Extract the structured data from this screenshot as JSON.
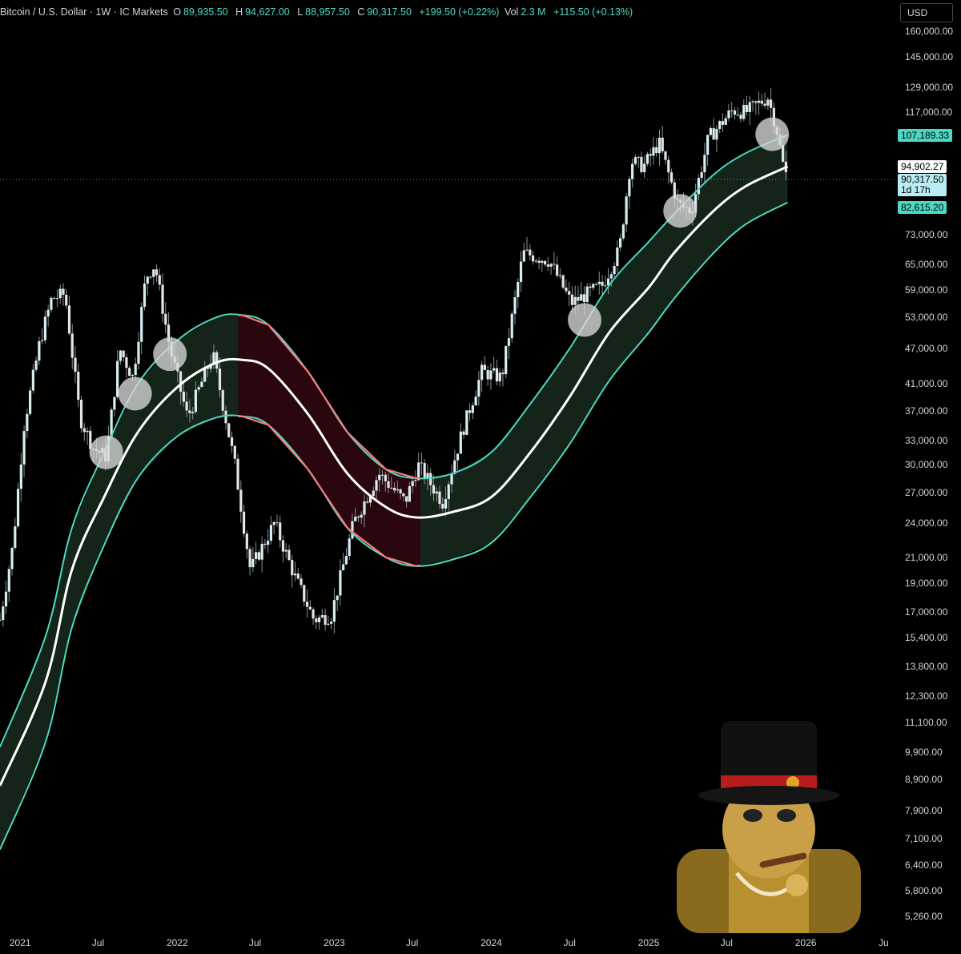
{
  "header": {
    "symbol": "Bitcoin / U.S. Dollar · 1W · IC Markets",
    "open_key": "O",
    "open": "89,935.50",
    "high_key": "H",
    "high": "94,627.00",
    "low_key": "L",
    "low": "88,957.50",
    "close_key": "C",
    "close": "90,317.50",
    "change": "+199.50 (+0.22%)",
    "vol_key": "Vol",
    "vol": "2.3 M",
    "vol_change": "+115.50 (+0.13%)"
  },
  "currency": "USD",
  "colors": {
    "accent": "#4dd8c4",
    "band_up_fill": "#142418",
    "band_down_fill": "#2a060e",
    "band_down_edge": "#f77c80",
    "midline": "#ffffff",
    "candle_up": "#d6eef2",
    "candle_down": "#e5e5e5",
    "wick": "#8a8f95",
    "touch_marker": "#d9d9d9",
    "mascot": "gold top-hat cigar bitcoin character"
  },
  "tags": {
    "upper_band": "107,189.33",
    "mid_line": "94,902.27",
    "close_price": "90,317.50",
    "countdown": "1d 17h",
    "lower_band": "82,615.20"
  },
  "chart_data": {
    "type": "line",
    "scale": "log",
    "ylim": [
      5000,
      175000
    ],
    "xlim": [
      "2020-11-15",
      "2026-08-01"
    ],
    "x_tick_labels": [
      {
        "date": "2021-01-01",
        "label": "2021"
      },
      {
        "date": "2021-07-01",
        "label": "Jul"
      },
      {
        "date": "2022-01-01",
        "label": "2022"
      },
      {
        "date": "2022-07-01",
        "label": "Jul"
      },
      {
        "date": "2023-01-01",
        "label": "2023"
      },
      {
        "date": "2023-07-01",
        "label": "Jul"
      },
      {
        "date": "2024-01-01",
        "label": "2024"
      },
      {
        "date": "2024-07-01",
        "label": "Jul"
      },
      {
        "date": "2025-01-01",
        "label": "2025"
      },
      {
        "date": "2025-07-01",
        "label": "Jul"
      },
      {
        "date": "2026-01-01",
        "label": "2026"
      },
      {
        "date": "2026-07-01",
        "label": "Ju"
      }
    ],
    "y_tick_labels": [
      {
        "value": 160000,
        "label": "160,000.00"
      },
      {
        "value": 145000,
        "label": "145,000.00"
      },
      {
        "value": 129000,
        "label": "129,000.00"
      },
      {
        "value": 117000,
        "label": "117,000.00"
      },
      {
        "value": 73000,
        "label": "73,000.00"
      },
      {
        "value": 65000,
        "label": "65,000.00"
      },
      {
        "value": 59000,
        "label": "59,000.00"
      },
      {
        "value": 53000,
        "label": "53,000.00"
      },
      {
        "value": 47000,
        "label": "47,000.00"
      },
      {
        "value": 41000,
        "label": "41,000.00"
      },
      {
        "value": 37000,
        "label": "37,000.00"
      },
      {
        "value": 33000,
        "label": "33,000.00"
      },
      {
        "value": 30000,
        "label": "30,000.00"
      },
      {
        "value": 27000,
        "label": "27,000.00"
      },
      {
        "value": 24000,
        "label": "24,000.00"
      },
      {
        "value": 21000,
        "label": "21,000.00"
      },
      {
        "value": 19000,
        "label": "19,000.00"
      },
      {
        "value": 17000,
        "label": "17,000.00"
      },
      {
        "value": 15400,
        "label": "15,400.00"
      },
      {
        "value": 13800,
        "label": "13,800.00"
      },
      {
        "value": 12300,
        "label": "12,300.00"
      },
      {
        "value": 11100,
        "label": "11,100.00"
      },
      {
        "value": 9900,
        "label": "9,900.00"
      },
      {
        "value": 8900,
        "label": "8,900.00"
      },
      {
        "value": 7900,
        "label": "7,900.00"
      },
      {
        "value": 7100,
        "label": "7,100.00"
      },
      {
        "value": 6400,
        "label": "6,400.00"
      },
      {
        "value": 5800,
        "label": "5,800.00"
      },
      {
        "value": 5260,
        "label": "5,260.00"
      }
    ],
    "series": [
      {
        "role": "upper-band",
        "points": [
          [
            "2020-11-15",
            10100
          ],
          [
            "2021-03-01",
            15500
          ],
          [
            "2021-05-01",
            23500
          ],
          [
            "2021-07-15",
            31500
          ],
          [
            "2021-10-01",
            41000
          ],
          [
            "2022-01-01",
            48500
          ],
          [
            "2022-04-01",
            53000
          ],
          [
            "2022-06-01",
            53500
          ],
          [
            "2022-08-01",
            51500
          ],
          [
            "2022-11-01",
            43000
          ],
          [
            "2023-02-01",
            34000
          ],
          [
            "2023-05-01",
            29500
          ],
          [
            "2023-07-10",
            28500
          ],
          [
            "2023-10-01",
            29000
          ],
          [
            "2024-01-01",
            31500
          ],
          [
            "2024-04-01",
            38000
          ],
          [
            "2024-07-01",
            47000
          ],
          [
            "2024-10-01",
            60000
          ],
          [
            "2025-01-01",
            71000
          ],
          [
            "2025-03-01",
            79000
          ],
          [
            "2025-06-01",
            92000
          ],
          [
            "2025-08-15",
            100000
          ],
          [
            "2025-11-20",
            107189.33
          ]
        ]
      },
      {
        "role": "mid-line",
        "points": [
          [
            "2020-11-15",
            8700
          ],
          [
            "2021-03-01",
            13000
          ],
          [
            "2021-05-01",
            20000
          ],
          [
            "2021-07-15",
            26500
          ],
          [
            "2021-10-01",
            34000
          ],
          [
            "2022-01-01",
            40500
          ],
          [
            "2022-04-01",
            44500
          ],
          [
            "2022-06-01",
            45000
          ],
          [
            "2022-08-01",
            43500
          ],
          [
            "2022-11-01",
            36500
          ],
          [
            "2023-02-01",
            29000
          ],
          [
            "2023-05-01",
            25500
          ],
          [
            "2023-07-10",
            24500
          ],
          [
            "2023-10-01",
            25000
          ],
          [
            "2024-01-01",
            26500
          ],
          [
            "2024-04-01",
            31500
          ],
          [
            "2024-07-01",
            39000
          ],
          [
            "2024-10-01",
            50000
          ],
          [
            "2025-01-01",
            59500
          ],
          [
            "2025-03-01",
            68000
          ],
          [
            "2025-06-01",
            80000
          ],
          [
            "2025-08-15",
            88000
          ],
          [
            "2025-11-20",
            94902.27
          ]
        ]
      },
      {
        "role": "lower-band",
        "points": [
          [
            "2020-11-15",
            6800
          ],
          [
            "2021-03-01",
            10300
          ],
          [
            "2021-05-01",
            16000
          ],
          [
            "2021-07-15",
            22000
          ],
          [
            "2021-10-01",
            28500
          ],
          [
            "2022-01-01",
            33500
          ],
          [
            "2022-04-01",
            36000
          ],
          [
            "2022-06-01",
            36200
          ],
          [
            "2022-08-01",
            35000
          ],
          [
            "2022-11-01",
            29500
          ],
          [
            "2023-02-01",
            23500
          ],
          [
            "2023-05-01",
            21000
          ],
          [
            "2023-07-10",
            20300
          ],
          [
            "2023-10-01",
            20800
          ],
          [
            "2024-01-01",
            22200
          ],
          [
            "2024-04-01",
            26500
          ],
          [
            "2024-07-01",
            32500
          ],
          [
            "2024-10-01",
            41500
          ],
          [
            "2025-01-01",
            50000
          ],
          [
            "2025-03-01",
            57000
          ],
          [
            "2025-06-01",
            68000
          ],
          [
            "2025-08-15",
            76000
          ],
          [
            "2025-11-20",
            82615.2
          ]
        ]
      },
      {
        "role": "price-close",
        "points": [
          [
            "2020-11-15",
            16500
          ],
          [
            "2020-12-15",
            22000
          ],
          [
            "2021-01-10",
            35000
          ],
          [
            "2021-02-15",
            48000
          ],
          [
            "2021-03-15",
            57000
          ],
          [
            "2021-04-15",
            58000
          ],
          [
            "2021-05-20",
            36000
          ],
          [
            "2021-06-20",
            32000
          ],
          [
            "2021-07-20",
            31000
          ],
          [
            "2021-08-20",
            47000
          ],
          [
            "2021-09-20",
            42000
          ],
          [
            "2021-10-20",
            62000
          ],
          [
            "2021-11-10",
            65000
          ],
          [
            "2021-12-15",
            47000
          ],
          [
            "2022-01-25",
            36000
          ],
          [
            "2022-03-25",
            46000
          ],
          [
            "2022-05-15",
            30000
          ],
          [
            "2022-06-20",
            20000
          ],
          [
            "2022-08-15",
            24000
          ],
          [
            "2022-10-01",
            19500
          ],
          [
            "2022-11-15",
            16500
          ],
          [
            "2022-12-25",
            16800
          ],
          [
            "2023-02-15",
            24000
          ],
          [
            "2023-04-15",
            29000
          ],
          [
            "2023-06-15",
            26000
          ],
          [
            "2023-07-15",
            30000
          ],
          [
            "2023-09-10",
            26000
          ],
          [
            "2023-10-25",
            34000
          ],
          [
            "2023-12-10",
            43000
          ],
          [
            "2024-01-25",
            42000
          ],
          [
            "2024-03-15",
            68000
          ],
          [
            "2024-05-15",
            66000
          ],
          [
            "2024-07-05",
            56000
          ],
          [
            "2024-08-10",
            58000
          ],
          [
            "2024-09-15",
            60000
          ],
          [
            "2024-10-25",
            69000
          ],
          [
            "2024-11-20",
            97000
          ],
          [
            "2024-12-20",
            95000
          ],
          [
            "2025-01-25",
            104000
          ],
          [
            "2025-03-10",
            82000
          ],
          [
            "2025-04-10",
            80000
          ],
          [
            "2025-05-20",
            106000
          ],
          [
            "2025-07-15",
            118000
          ],
          [
            "2025-08-15",
            117000
          ],
          [
            "2025-10-05",
            124000
          ],
          [
            "2025-10-25",
            110000
          ],
          [
            "2025-11-10",
            95000
          ],
          [
            "2025-11-20",
            90317.5
          ]
        ]
      }
    ],
    "touch_points": [
      [
        "2021-07-20",
        31500
      ],
      [
        "2021-09-25",
        39500
      ],
      [
        "2021-12-15",
        46000
      ],
      [
        "2024-08-05",
        52500
      ],
      [
        "2025-03-15",
        80000
      ],
      [
        "2025-10-15",
        107500
      ]
    ],
    "bearish_band_range": [
      "2022-05-23",
      "2023-07-20"
    ]
  }
}
